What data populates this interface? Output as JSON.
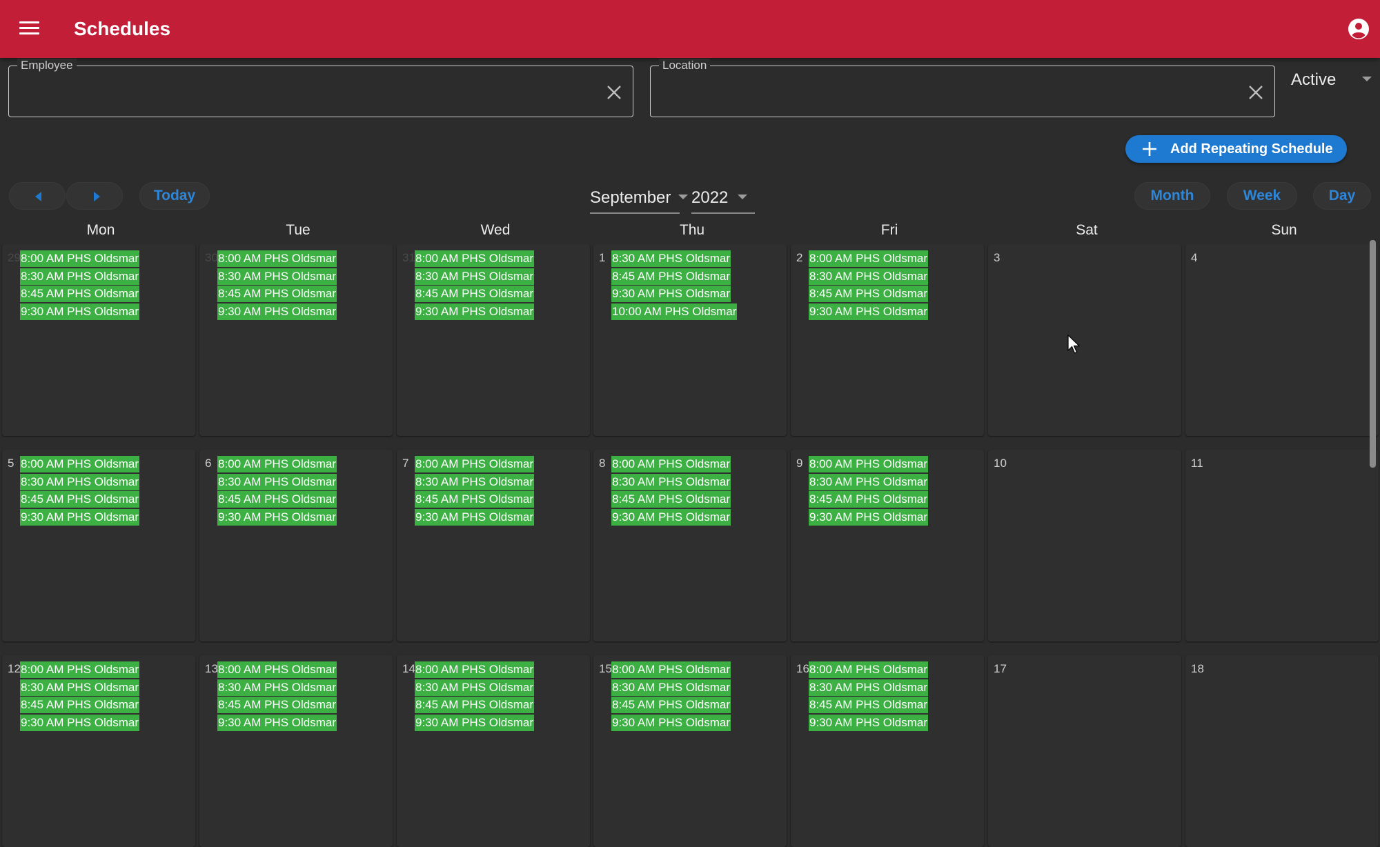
{
  "app": {
    "title": "Schedules"
  },
  "filters": {
    "employee_label": "Employee",
    "employee_value": "",
    "location_label": "Location",
    "location_value": "",
    "status_value": "Active"
  },
  "actions": {
    "add_repeating_label": "Add Repeating Schedule"
  },
  "toolbar": {
    "today_label": "Today",
    "month_value": "September",
    "year_value": "2022",
    "views": [
      "Month",
      "Week",
      "Day"
    ]
  },
  "calendar": {
    "weekdays": [
      "Mon",
      "Tue",
      "Wed",
      "Thu",
      "Fri",
      "Sat",
      "Sun"
    ],
    "weeks": [
      [
        {
          "day": "29",
          "muted": true,
          "events": [
            "8:00 AM PHS Oldsmar",
            "8:30 AM PHS Oldsmar",
            "8:45 AM PHS Oldsmar",
            "9:30 AM PHS Oldsmar"
          ]
        },
        {
          "day": "30",
          "muted": true,
          "events": [
            "8:00 AM PHS Oldsmar",
            "8:30 AM PHS Oldsmar",
            "8:45 AM PHS Oldsmar",
            "9:30 AM PHS Oldsmar"
          ]
        },
        {
          "day": "31",
          "muted": true,
          "events": [
            "8:00 AM PHS Oldsmar",
            "8:30 AM PHS Oldsmar",
            "8:45 AM PHS Oldsmar",
            "9:30 AM PHS Oldsmar"
          ]
        },
        {
          "day": "1",
          "events": [
            "8:30 AM PHS Oldsmar",
            "8:45 AM PHS Oldsmar",
            "9:30 AM PHS Oldsmar",
            "10:00 AM PHS Oldsmar"
          ]
        },
        {
          "day": "2",
          "events": [
            "8:00 AM PHS Oldsmar",
            "8:30 AM PHS Oldsmar",
            "8:45 AM PHS Oldsmar",
            "9:30 AM PHS Oldsmar"
          ]
        },
        {
          "day": "3",
          "events": []
        },
        {
          "day": "4",
          "events": []
        }
      ],
      [
        {
          "day": "5",
          "events": [
            "8:00 AM PHS Oldsmar",
            "8:30 AM PHS Oldsmar",
            "8:45 AM PHS Oldsmar",
            "9:30 AM PHS Oldsmar"
          ]
        },
        {
          "day": "6",
          "events": [
            "8:00 AM PHS Oldsmar",
            "8:30 AM PHS Oldsmar",
            "8:45 AM PHS Oldsmar",
            "9:30 AM PHS Oldsmar"
          ]
        },
        {
          "day": "7",
          "events": [
            "8:00 AM PHS Oldsmar",
            "8:30 AM PHS Oldsmar",
            "8:45 AM PHS Oldsmar",
            "9:30 AM PHS Oldsmar"
          ]
        },
        {
          "day": "8",
          "events": [
            "8:00 AM PHS Oldsmar",
            "8:30 AM PHS Oldsmar",
            "8:45 AM PHS Oldsmar",
            "9:30 AM PHS Oldsmar"
          ]
        },
        {
          "day": "9",
          "events": [
            "8:00 AM PHS Oldsmar",
            "8:30 AM PHS Oldsmar",
            "8:45 AM PHS Oldsmar",
            "9:30 AM PHS Oldsmar"
          ]
        },
        {
          "day": "10",
          "events": []
        },
        {
          "day": "11",
          "events": []
        }
      ],
      [
        {
          "day": "12",
          "events": [
            "8:00 AM PHS Oldsmar",
            "8:30 AM PHS Oldsmar",
            "8:45 AM PHS Oldsmar",
            "9:30 AM PHS Oldsmar"
          ]
        },
        {
          "day": "13",
          "events": [
            "8:00 AM PHS Oldsmar",
            "8:30 AM PHS Oldsmar",
            "8:45 AM PHS Oldsmar",
            "9:30 AM PHS Oldsmar"
          ]
        },
        {
          "day": "14",
          "events": [
            "8:00 AM PHS Oldsmar",
            "8:30 AM PHS Oldsmar",
            "8:45 AM PHS Oldsmar",
            "9:30 AM PHS Oldsmar"
          ]
        },
        {
          "day": "15",
          "events": [
            "8:00 AM PHS Oldsmar",
            "8:30 AM PHS Oldsmar",
            "8:45 AM PHS Oldsmar",
            "9:30 AM PHS Oldsmar"
          ]
        },
        {
          "day": "16",
          "events": [
            "8:00 AM PHS Oldsmar",
            "8:30 AM PHS Oldsmar",
            "8:45 AM PHS Oldsmar",
            "9:30 AM PHS Oldsmar"
          ]
        },
        {
          "day": "17",
          "events": []
        },
        {
          "day": "18",
          "events": []
        }
      ]
    ]
  },
  "colors": {
    "appbar": "#c21e37",
    "accent": "#1e7ad0",
    "event": "#3cb043",
    "background": "#2c2c2c"
  },
  "icons": [
    "menu-icon",
    "account-circle-icon",
    "close-icon",
    "plus-icon",
    "chevron-left-icon",
    "chevron-right-icon",
    "dropdown-caret-icon",
    "mouse-cursor-icon"
  ]
}
